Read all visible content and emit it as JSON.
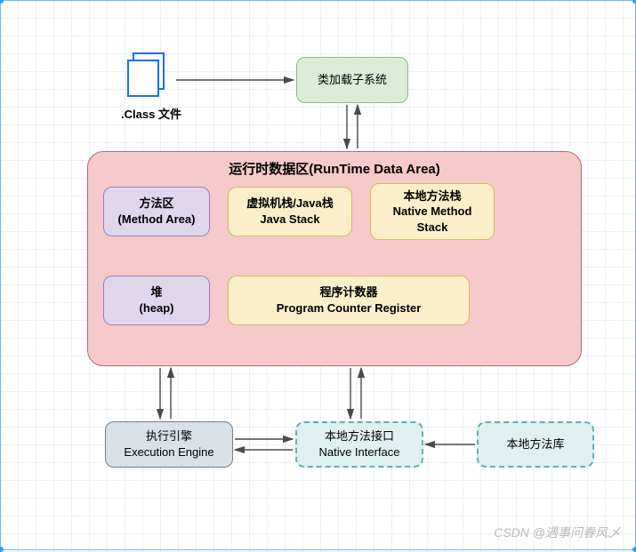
{
  "nodes": {
    "class_file_label": ".Class 文件",
    "classloader": "类加载子系统",
    "runtime_title": "运行时数据区(RunTime Data Area)",
    "method_area_l1": "方法区",
    "method_area_l2": "(Method Area)",
    "java_stack_l1": "虚拟机栈/Java栈",
    "java_stack_l2": "Java Stack",
    "native_stack_l1": "本地方法栈",
    "native_stack_l2": "Native Method",
    "native_stack_l3": "Stack",
    "heap_l1": "堆",
    "heap_l2": "(heap)",
    "pcr_l1": "程序计数器",
    "pcr_l2": "Program Counter Register",
    "exec_l1": "执行引擎",
    "exec_l2": "Execution Engine",
    "native_if_l1": "本地方法接口",
    "native_if_l2": "Native Interface",
    "native_lib": "本地方法库"
  },
  "watermark": "CSDN @遇事问春风乄",
  "colors": {
    "grid": "#eaf0f5",
    "green_fill": "#dcecd8",
    "green_border": "#8fb77e",
    "pink_fill": "#f6c9cb",
    "pink_border": "#b06a6d",
    "purple_fill": "#e0d6ec",
    "purple_border": "#9a80bb",
    "yellow_fill": "#fbeecb",
    "yellow_border": "#d3b95f",
    "grey_fill": "#d9e0e6",
    "grey_border": "#6f7f8c",
    "teal_fill": "#def0f0",
    "teal_border": "#5fb0b0",
    "arrow": "#4a4a4a",
    "file_icon": "#1a6dff"
  }
}
